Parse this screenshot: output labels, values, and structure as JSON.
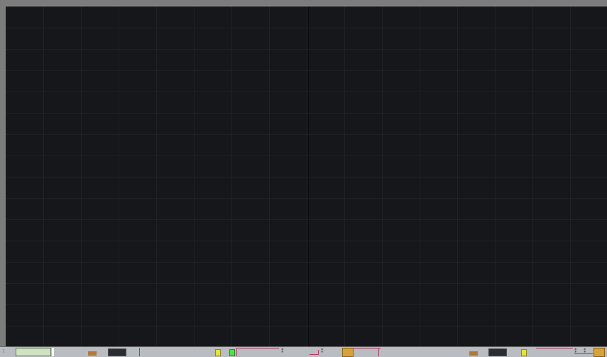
{
  "workspace": {
    "canvas": {
      "background": "#15171a",
      "grid": true,
      "grid_color": "#222428"
    },
    "overview": {
      "background": "#b9bcc0",
      "wire_color": "#b03a6a",
      "node_colors": [
        "#b0793a",
        "#2a2c30",
        "#e8e23a",
        "#4de24a",
        "#d7a23a",
        "#cfe3c2"
      ]
    }
  }
}
